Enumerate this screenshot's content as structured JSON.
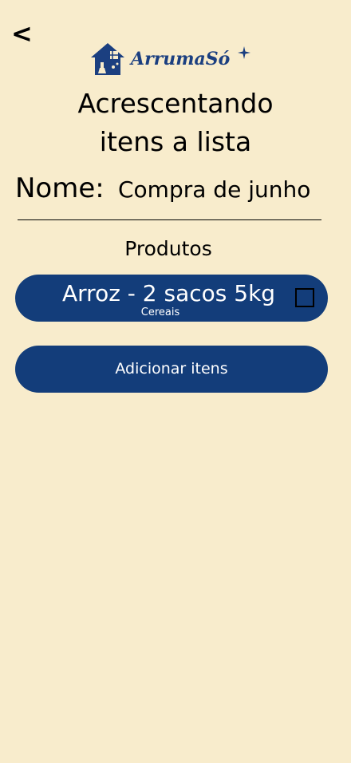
{
  "header": {
    "back_label": "<",
    "logo_text": "ArrumaSó"
  },
  "title": {
    "line1": "Acrescentando",
    "line2": "itens a lista"
  },
  "list_name": {
    "label": "Nome:",
    "value": "Compra de junho"
  },
  "products": {
    "heading": "Produtos",
    "items": [
      {
        "name": "Arroz - 2 sacos 5kg",
        "category": "Cereais",
        "checked": false
      }
    ]
  },
  "actions": {
    "add_label": "Adicionar itens"
  },
  "colors": {
    "background": "#f8eccc",
    "primary": "#133d7a",
    "logo": "#1b3f80"
  }
}
